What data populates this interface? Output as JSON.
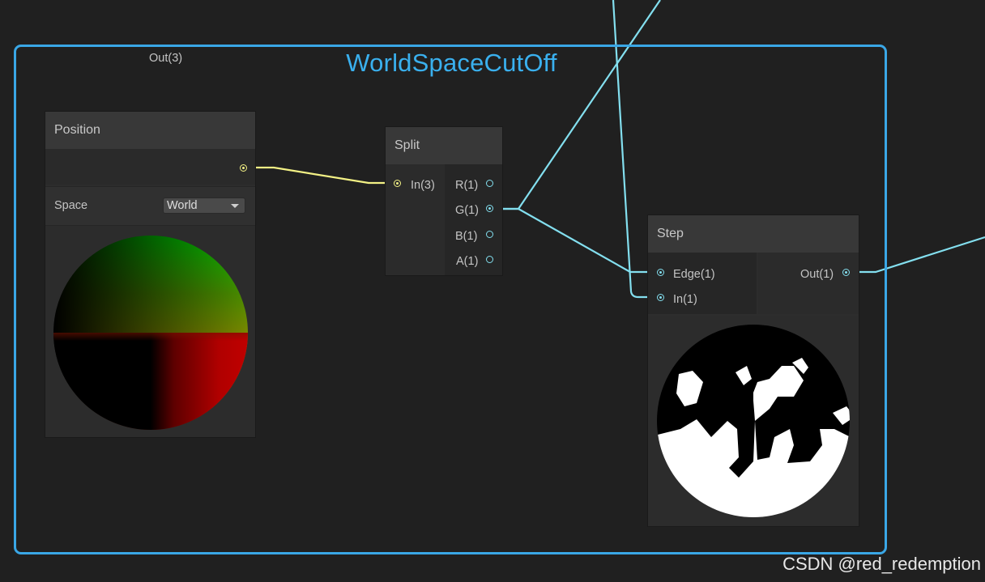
{
  "group": {
    "title": "WorldSpaceCutOff"
  },
  "nodes": {
    "position": {
      "title": "Position",
      "out_label": "Out(3)",
      "space_label": "Space",
      "space_value": "World"
    },
    "split": {
      "title": "Split",
      "in_label": "In(3)",
      "outputs": [
        "R(1)",
        "G(1)",
        "B(1)",
        "A(1)"
      ]
    },
    "step": {
      "title": "Step",
      "inputs": [
        "Edge(1)",
        "In(1)"
      ],
      "out_label": "Out(1)"
    }
  },
  "colors": {
    "group_border": "#3aa7e6",
    "vector3_wire": "#f3f185",
    "float_wire": "#83dfef"
  },
  "watermark": "CSDN @red_redemption"
}
